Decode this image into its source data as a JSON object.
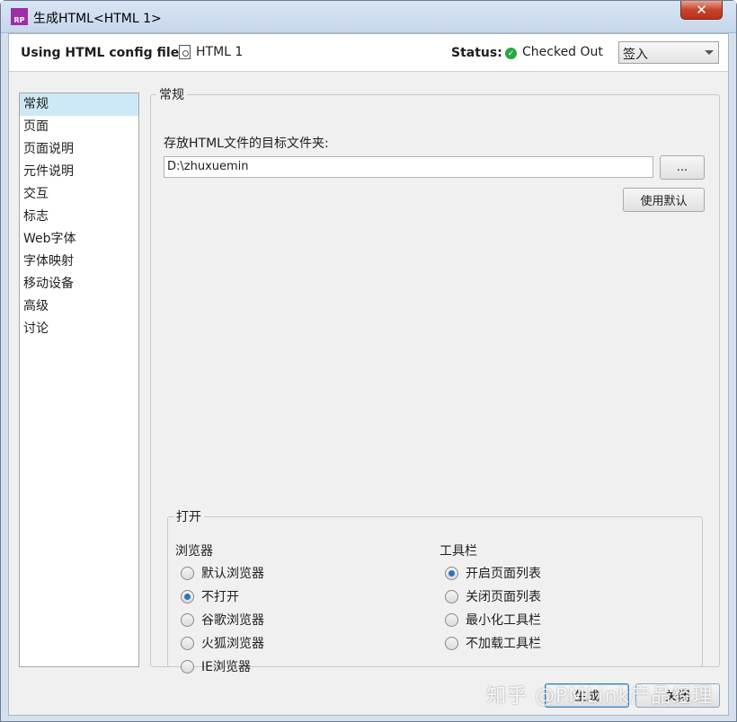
{
  "window": {
    "title": "生成HTML<HTML 1>",
    "app_icon_text": "RP",
    "close_glyph": "✕"
  },
  "config": {
    "label": "Using HTML config file:",
    "file_name": "HTML 1",
    "status_label": "Status:",
    "status_value": "Checked Out",
    "status_color": "#28a745",
    "action_select": "签入"
  },
  "nav": {
    "items": [
      "常规",
      "页面",
      "页面说明",
      "元件说明",
      "交互",
      "标志",
      "Web字体",
      "字体映射",
      "移动设备",
      "高级",
      "讨论"
    ],
    "selected_index": 0
  },
  "general": {
    "legend": "常规",
    "dir_label": "存放HTML文件的目标文件夹:",
    "dir_value": "D:\\zhuxuemin",
    "browse_label": "...",
    "default_label": "使用默认"
  },
  "open_section": {
    "legend": "打开",
    "browser": {
      "heading": "浏览器",
      "options": [
        "默认浏览器",
        "不打开",
        "谷歌浏览器",
        "火狐浏览器",
        "IE浏览器"
      ],
      "selected_index": 1
    },
    "toolbar": {
      "heading": "工具栏",
      "options": [
        "开启页面列表",
        "关闭页面列表",
        "最小化工具栏",
        "不加载工具栏"
      ],
      "selected_index": 0
    }
  },
  "footer": {
    "generate_label": "生成",
    "close_label": "关闭"
  },
  "watermark": "知乎 @PMLink产品经理"
}
